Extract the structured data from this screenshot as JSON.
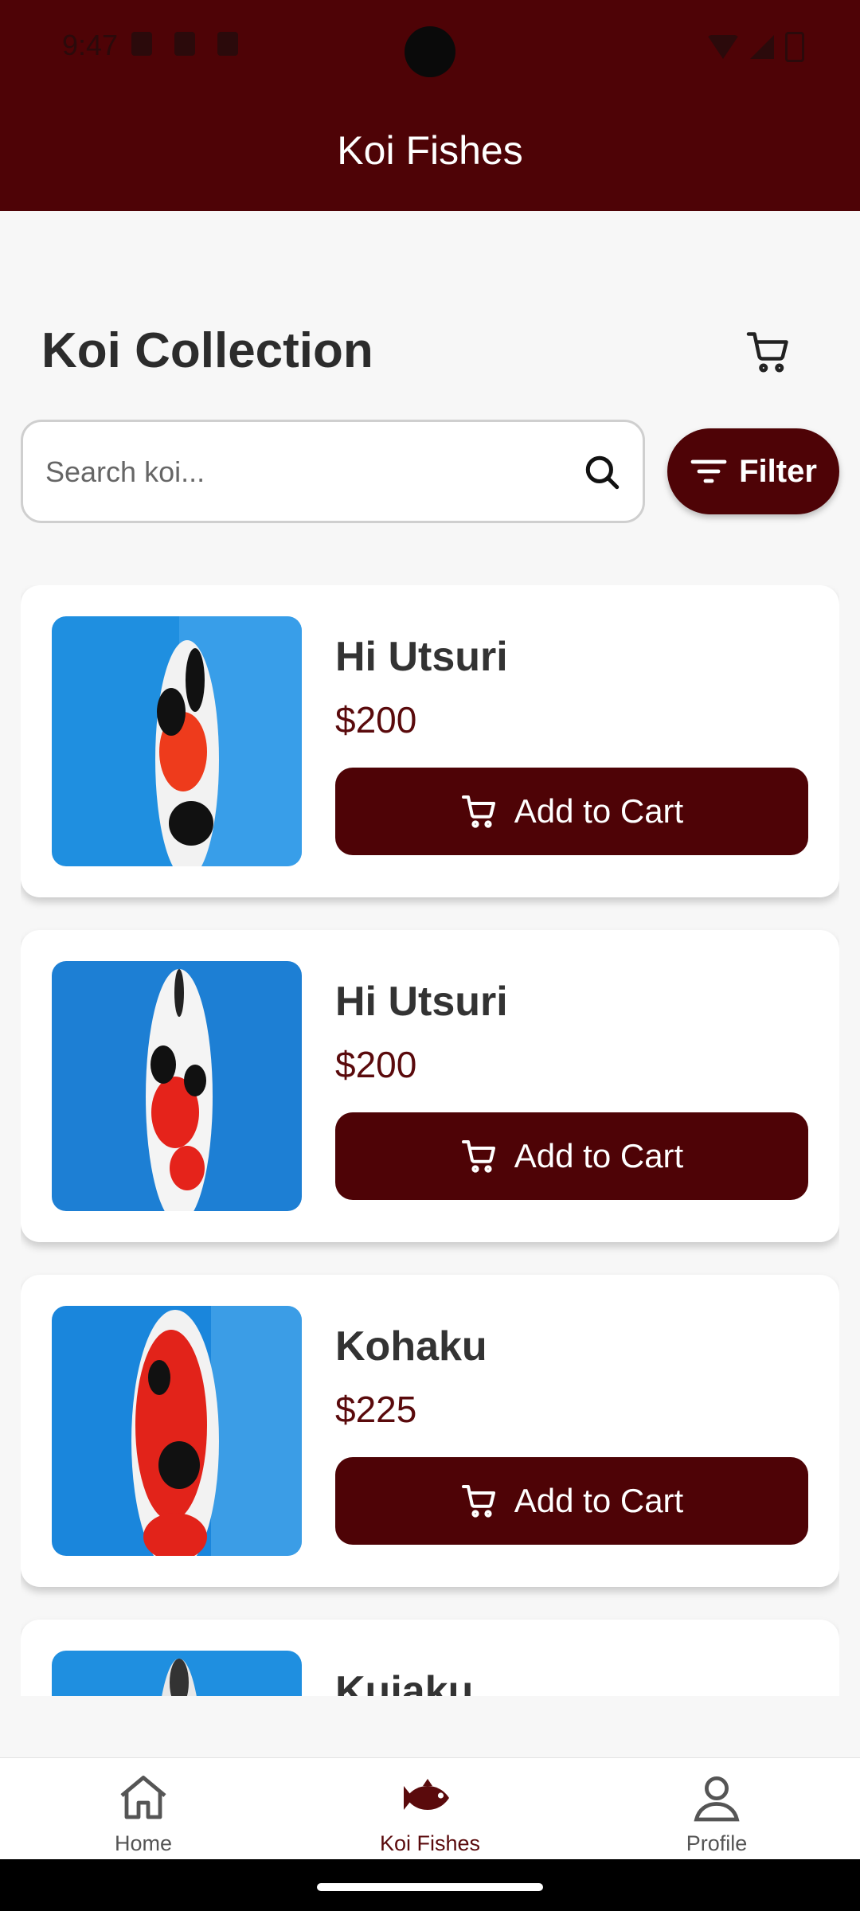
{
  "status_bar": {
    "time": "9:47"
  },
  "app_bar": {
    "title": "Koi Fishes"
  },
  "header": {
    "title": "Koi Collection"
  },
  "search": {
    "placeholder": "Search koi...",
    "value": ""
  },
  "filter": {
    "label": "Filter"
  },
  "products": [
    {
      "name": "Hi Utsuri",
      "price": "$200",
      "button": "Add to Cart"
    },
    {
      "name": "Hi Utsuri",
      "price": "$200",
      "button": "Add to Cart"
    },
    {
      "name": "Kohaku",
      "price": "$225",
      "button": "Add to Cart"
    },
    {
      "name": "Kujaku",
      "price": "",
      "button": ""
    }
  ],
  "nav": {
    "items": [
      {
        "label": "Home"
      },
      {
        "label": "Koi Fishes"
      },
      {
        "label": "Profile"
      }
    ],
    "active_index": 1
  },
  "colors": {
    "primary": "#4e0306",
    "price": "#5a0a0c",
    "background": "#f7f7f7"
  }
}
